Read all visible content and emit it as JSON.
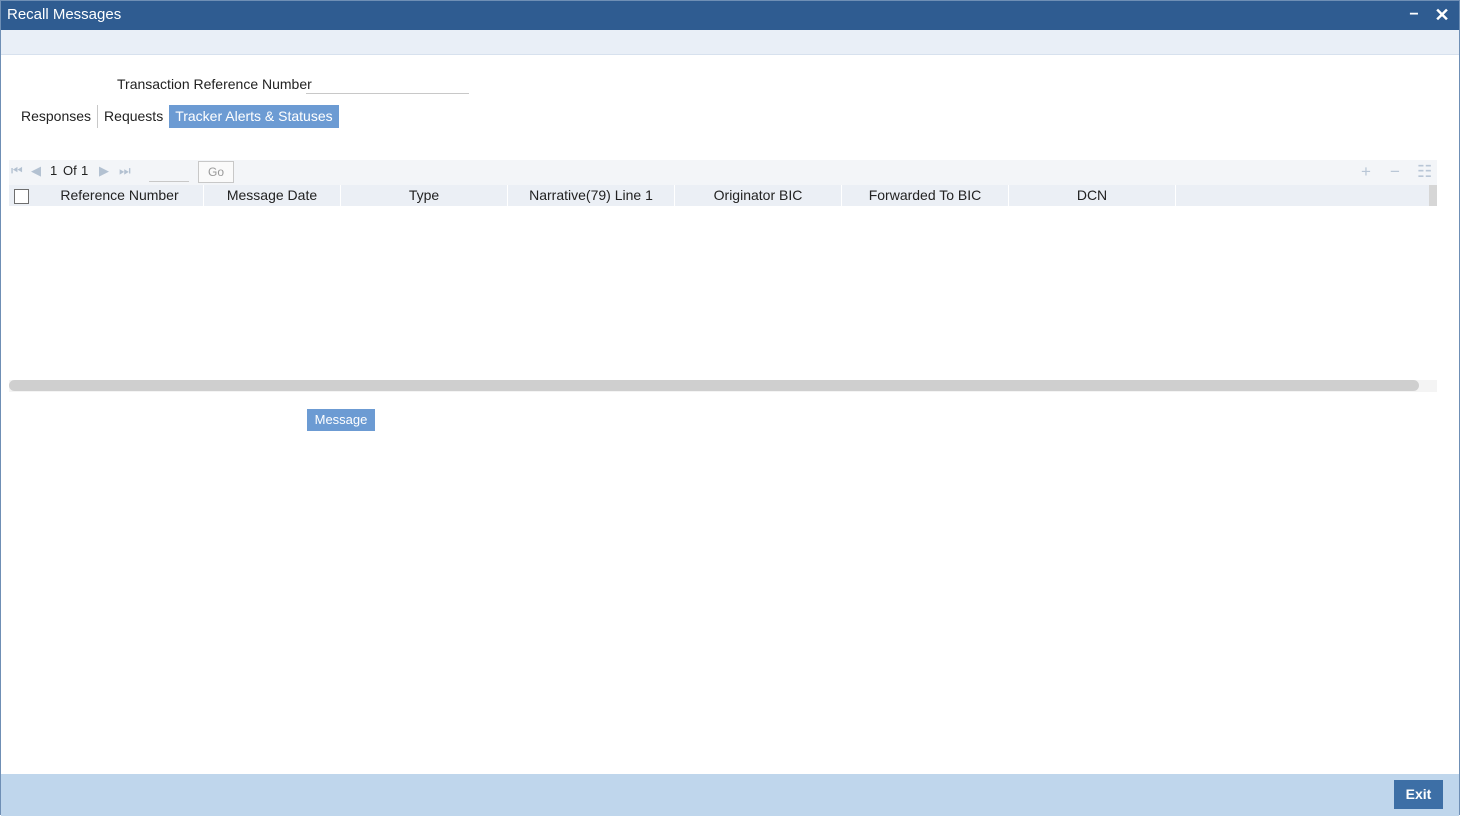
{
  "window": {
    "title": "Recall Messages",
    "minimize_symbol": "−",
    "close_symbol": "✕"
  },
  "form": {
    "transaction_reference_label": "Transaction Reference Number",
    "transaction_reference_value": ""
  },
  "tabs": [
    {
      "label": "Responses",
      "active": false
    },
    {
      "label": "Requests",
      "active": false
    },
    {
      "label": "Tracker Alerts & Statuses",
      "active": true
    }
  ],
  "pager": {
    "current": "1",
    "of_label": "Of",
    "total": "1",
    "go_label": "Go",
    "goto_value": ""
  },
  "grid": {
    "columns": [
      "Reference Number",
      "Message Date",
      "Type",
      "Narrative(79) Line 1",
      "Originator BIC",
      "Forwarded To BIC",
      "DCN"
    ],
    "rows": []
  },
  "buttons": {
    "message_label": "Message",
    "exit_label": "Exit"
  },
  "icons": {
    "first_page": "first-page-icon",
    "prev_page": "prev-page-icon",
    "next_page": "next-page-icon",
    "last_page": "last-page-icon",
    "add_row": "add-row-icon",
    "delete_row": "delete-row-icon",
    "single_view": "single-view-icon"
  },
  "colors": {
    "titlebar": "#2f5c91",
    "accent": "#6c9bd3",
    "footer": "#bfd6ec",
    "exit_button": "#3d6fa6"
  }
}
